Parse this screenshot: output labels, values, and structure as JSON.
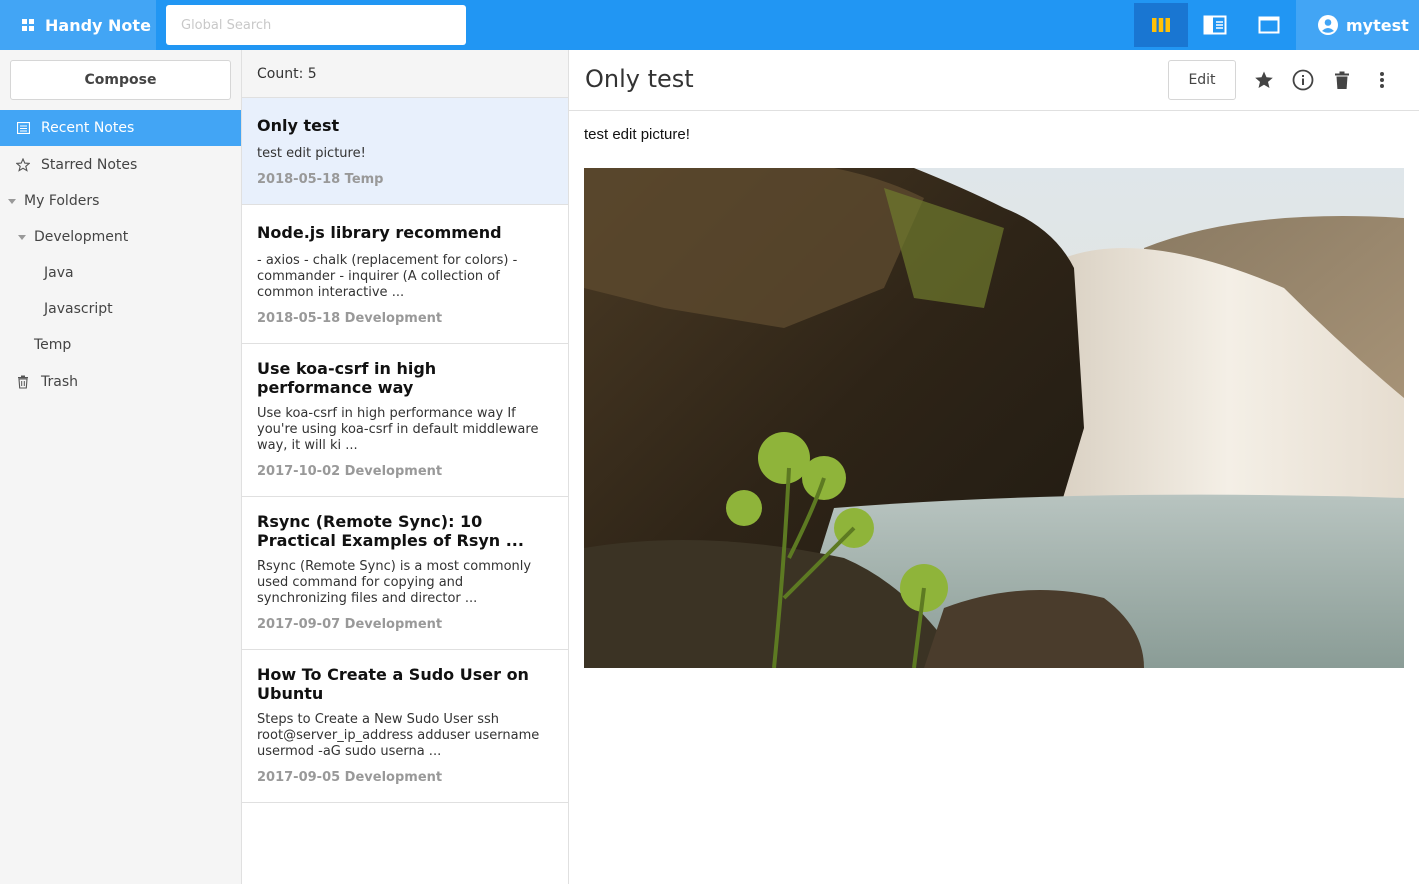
{
  "app": {
    "name": "Handy Note"
  },
  "search": {
    "placeholder": "Global Search"
  },
  "user": {
    "name": "mytest"
  },
  "colors": {
    "primary": "#2196f3",
    "brand_bg": "#42a5f5",
    "active_view": "#1976d2",
    "selected_note": "#e8f0fc"
  },
  "sidebar": {
    "compose_label": "Compose",
    "recent": "Recent Notes",
    "starred": "Starred Notes",
    "my_folders": "My Folders",
    "development": "Development",
    "java": "Java",
    "javascript": "Javascript",
    "temp": "Temp",
    "trash": "Trash"
  },
  "list": {
    "count_text": "Count: 5",
    "notes": [
      {
        "title": "Only test",
        "summary": "test edit picture!",
        "meta": "2018-05-18 Temp"
      },
      {
        "title": "Node.js library recommend",
        "summary": "- axios - chalk (replacement for colors) - commander - inquirer (A collection of common interactive ...",
        "meta": "2018-05-18 Development"
      },
      {
        "title": "Use koa-csrf in high performance way",
        "summary": "Use koa-csrf in high performance way If you're using koa-csrf in default middleware way, it will ki ...",
        "meta": "2017-10-02 Development"
      },
      {
        "title": "Rsync (Remote Sync): 10 Practical Examples of Rsyn ...",
        "summary": "Rsync (Remote Sync) is a most commonly used command for copying and synchronizing files and director ...",
        "meta": "2017-09-07 Development"
      },
      {
        "title": "How To Create a Sudo User on Ubuntu",
        "summary": "Steps to Create a New Sudo User ssh root@server_ip_address adduser username usermod -aG sudo userna ...",
        "meta": "2017-09-05 Development"
      }
    ]
  },
  "content": {
    "title": "Only test",
    "edit_label": "Edit",
    "body": "test edit picture!"
  }
}
